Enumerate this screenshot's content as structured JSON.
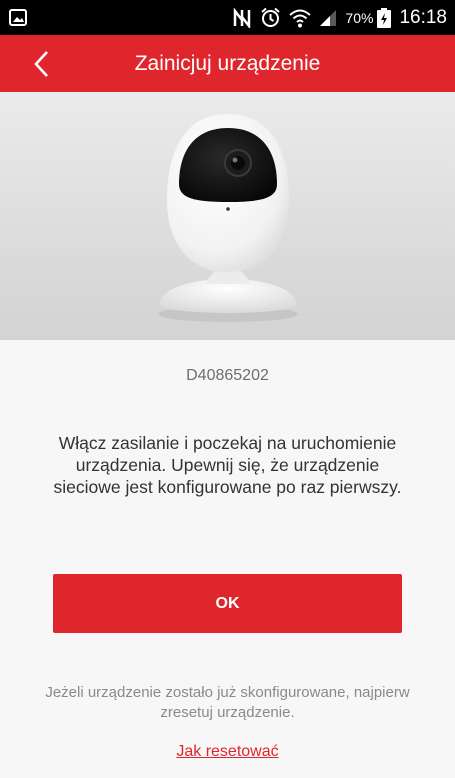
{
  "status_bar": {
    "battery_percent": "70%",
    "time": "16:18",
    "icons": [
      "image-notification-icon",
      "nfc-icon",
      "alarm-icon",
      "wifi-icon",
      "signal-icon",
      "battery-charging-icon"
    ]
  },
  "header": {
    "title": "Zainicjuj urządzenie",
    "back_icon": "chevron-left-icon"
  },
  "device": {
    "image": "camera-image",
    "id": "D40865202"
  },
  "main": {
    "instructions": "Włącz zasilanie i poczekaj na uruchomienie urządzenia. Upewnij się, że urządzenie sieciowe jest konfigurowane po raz pierwszy.",
    "ok_label": "OK",
    "note": "Jeżeli urządzenie zostało już skonfigurowane, najpierw zresetuj urządzenie.",
    "reset_link": "Jak resetować"
  },
  "colors": {
    "accent": "#e0262d",
    "background": "#f7f7f7",
    "status_bar": "#000000"
  }
}
